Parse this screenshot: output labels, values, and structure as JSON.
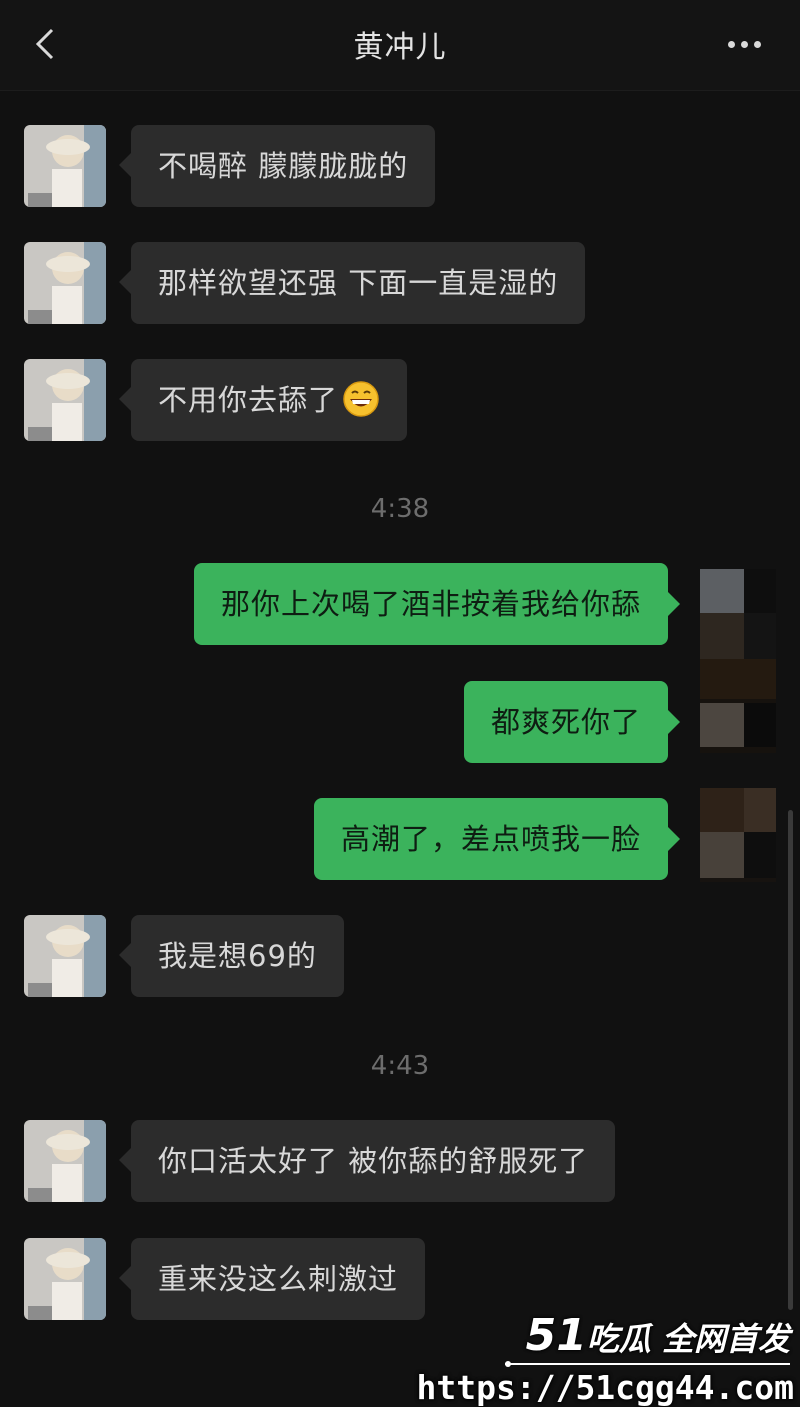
{
  "header": {
    "title": "黄冲儿",
    "back_icon": "chevron-left-icon",
    "more_icon": "more-dots-icon"
  },
  "messages": [
    {
      "side": "in",
      "text": "不喝醉 朦朦胧胧的"
    },
    {
      "side": "in",
      "text": "那样欲望还强 下面一直是湿的"
    },
    {
      "side": "in",
      "text": "不用你去舔了",
      "emoji": "grinning-face-emoji"
    },
    {
      "type": "time",
      "text": "4:38"
    },
    {
      "side": "out",
      "text": "那你上次喝了酒非按着我给你舔"
    },
    {
      "side": "out",
      "text": "都爽死你了"
    },
    {
      "side": "out",
      "text": "高潮了，差点喷我一脸"
    },
    {
      "side": "in",
      "text": "我是想69的"
    },
    {
      "type": "time",
      "text": "4:43"
    },
    {
      "side": "in",
      "text": "你口活太好了 被你舔的舒服死了"
    },
    {
      "side": "in",
      "text": "重来没这么刺激过"
    }
  ],
  "colors": {
    "background": "#111111",
    "incoming_bubble": "#2c2c2c",
    "outgoing_bubble": "#3bb35c"
  },
  "watermark": {
    "brand_num": "51",
    "brand_text": "吃瓜 全网首发",
    "url": "https://51cgg44.com"
  }
}
